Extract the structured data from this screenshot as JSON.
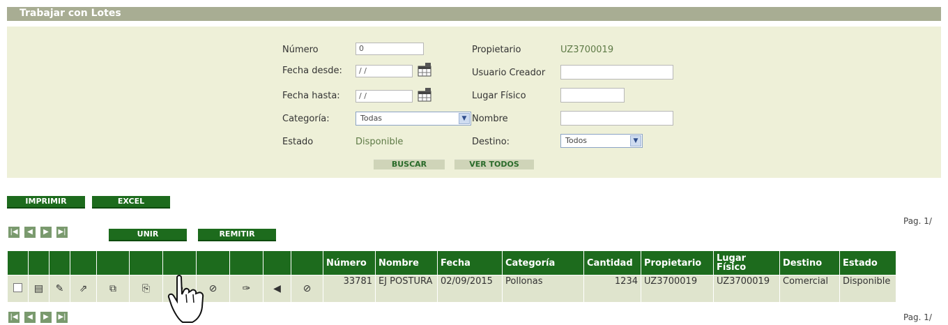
{
  "title": "Trabajar con Lotes",
  "filters": {
    "numero_label": "Número",
    "numero_value": "0",
    "fecha_desde_label": "Fecha desde:",
    "fecha_desde_value": "/ /",
    "fecha_hasta_label": "Fecha hasta:",
    "fecha_hasta_value": "/ /",
    "categoria_label": "Categoría:",
    "categoria_value": "Todas",
    "estado_label": "Estado",
    "estado_value": "Disponible",
    "propietario_label": "Propietario",
    "propietario_value": "UZ3700019",
    "usuario_label": "Usuario Creador",
    "usuario_value": "",
    "lugar_label": "Lugar Físico",
    "lugar_value": "",
    "nombre_label": "Nombre",
    "nombre_value": "",
    "destino_label": "Destino:",
    "destino_value": "Todos",
    "buscar": "BUSCAR",
    "ver_todos": "VER TODOS"
  },
  "actions": {
    "imprimir": "IMPRIMIR",
    "excel": "EXCEL",
    "unir": "UNIR",
    "remitir": "REMITIR"
  },
  "pagination": {
    "top": "Pag. 1/",
    "bottom": "Pag. 1/"
  },
  "table": {
    "headers": [
      "Número",
      "Nombre",
      "Fecha",
      "Categoría",
      "Cantidad",
      "Propietario",
      "Lugar Físico",
      "Destino",
      "Estado"
    ],
    "row": {
      "numero": "33781",
      "nombre": "EJ POSTURA",
      "fecha": "02/09/2015",
      "categoria": "Pollonas",
      "cantidad": "1234",
      "propietario": "UZ3700019",
      "lugar": "UZ3700019",
      "destino": "Comercial",
      "estado": "Disponible"
    }
  },
  "icons": [
    "checkbox",
    "detail-icon",
    "edit-icon",
    "move-icon",
    "expand-icon",
    "copy-icon",
    "cancel-icon",
    "cancel-icon",
    "pen-icon",
    "arrow-left-icon",
    "cancel-icon"
  ]
}
